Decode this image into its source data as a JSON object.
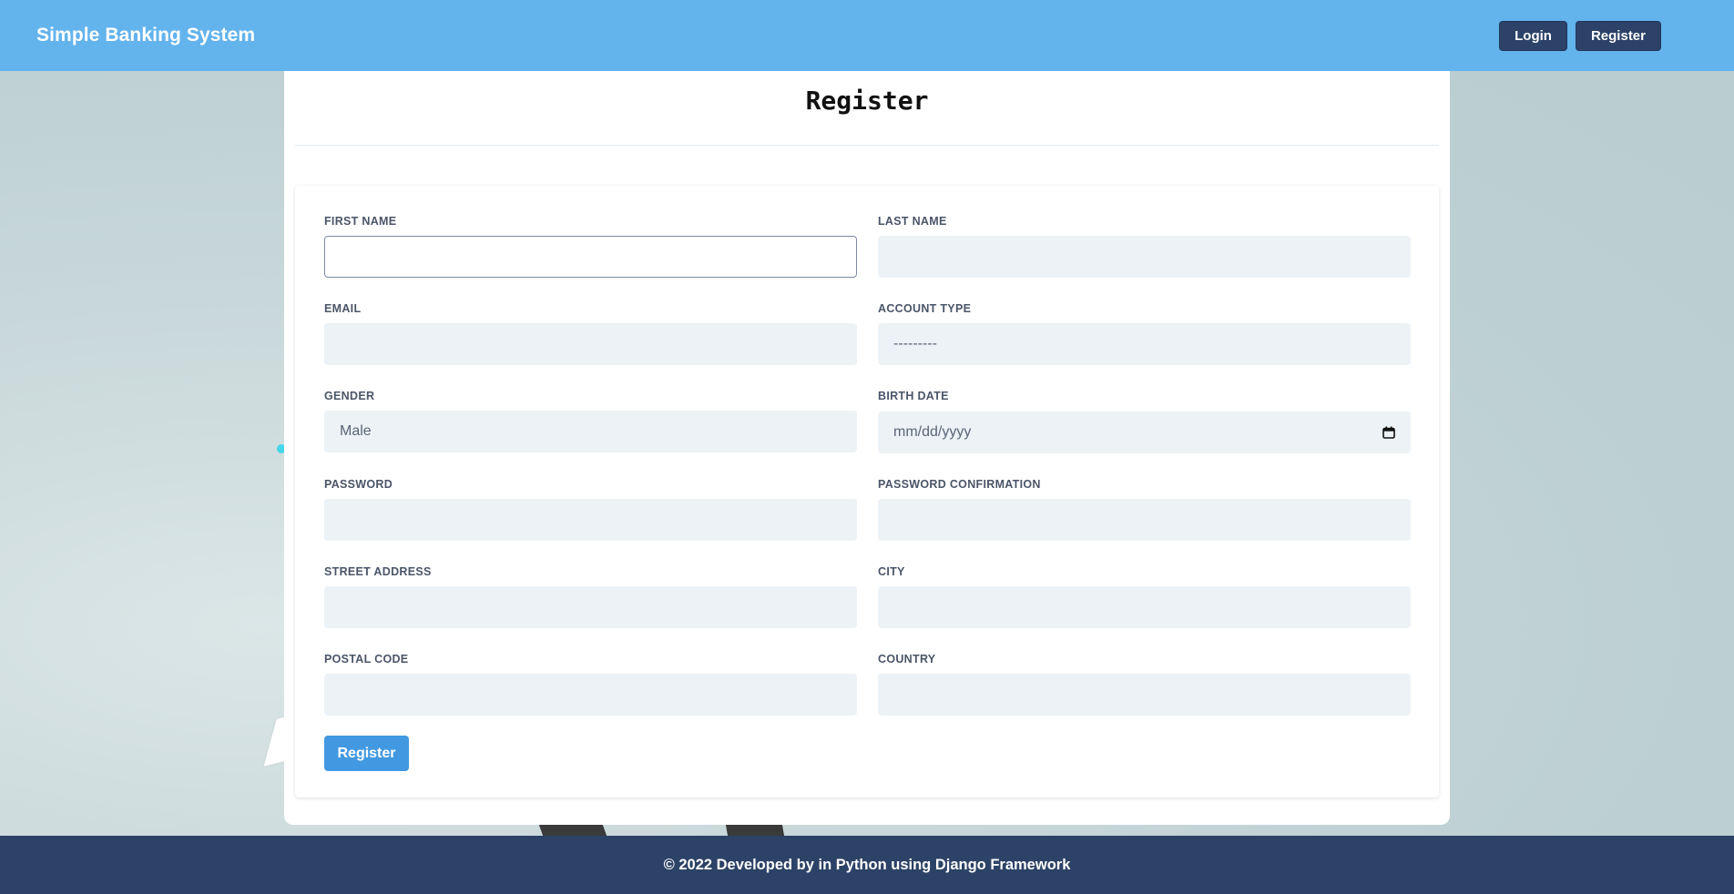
{
  "navbar": {
    "brand": "Simple Banking System",
    "login_label": "Login",
    "register_label": "Register"
  },
  "card": {
    "title": "Register"
  },
  "form": {
    "first_name": {
      "label": "FIRST NAME",
      "value": ""
    },
    "last_name": {
      "label": "LAST NAME",
      "value": ""
    },
    "email": {
      "label": "EMAIL",
      "value": ""
    },
    "account_type": {
      "label": "ACCOUNT TYPE",
      "value": "---------"
    },
    "gender": {
      "label": "GENDER",
      "value": "Male"
    },
    "birth_date": {
      "label": "BIRTH DATE",
      "placeholder": "mm/dd/yyyy"
    },
    "password": {
      "label": "PASSWORD",
      "value": ""
    },
    "password_confirmation": {
      "label": "PASSWORD CONFIRMATION",
      "value": ""
    },
    "street_address": {
      "label": "STREET ADDRESS",
      "value": ""
    },
    "city": {
      "label": "CITY",
      "value": ""
    },
    "postal_code": {
      "label": "POSTAL CODE",
      "value": ""
    },
    "country": {
      "label": "COUNTRY",
      "value": ""
    },
    "submit_label": "Register"
  },
  "footer": {
    "text": "© 2022 Developed by in Python using Django Framework"
  },
  "colors": {
    "navbar": "#63b3ed",
    "nav_button": "#2c4268",
    "submit_button": "#4299e1",
    "footer": "#2c4266",
    "input_bg": "#edf2f7"
  },
  "icons": {
    "calendar": "calendar-icon"
  }
}
